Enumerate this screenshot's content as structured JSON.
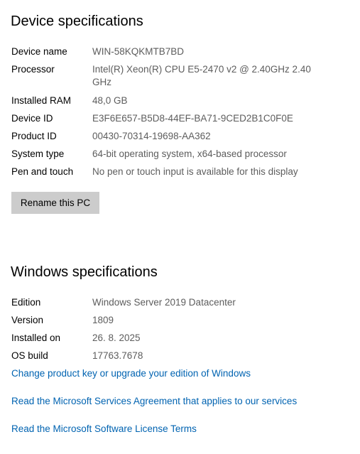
{
  "device": {
    "title": "Device specifications",
    "rows": [
      {
        "label": "Device name",
        "value": "WIN-58KQKMTB7BD"
      },
      {
        "label": "Processor",
        "value": "Intel(R) Xeon(R) CPU E5-2470 v2 @ 2.40GHz   2.40 GHz"
      },
      {
        "label": "Installed RAM",
        "value": "48,0 GB"
      },
      {
        "label": "Device ID",
        "value": "E3F6E657-B5D8-44EF-BA71-9CED2B1C0F0E"
      },
      {
        "label": "Product ID",
        "value": "00430-70314-19698-AA362"
      },
      {
        "label": "System type",
        "value": "64-bit operating system, x64-based processor"
      },
      {
        "label": "Pen and touch",
        "value": "No pen or touch input is available for this display"
      }
    ],
    "rename_label": "Rename this PC"
  },
  "windows": {
    "title": "Windows specifications",
    "rows": [
      {
        "label": "Edition",
        "value": "Windows Server 2019 Datacenter"
      },
      {
        "label": "Version",
        "value": "1809"
      },
      {
        "label": "Installed on",
        "value": "26. 8. 2025"
      },
      {
        "label": "OS build",
        "value": "17763.7678"
      }
    ],
    "links": {
      "change_key": "Change product key or upgrade your edition of Windows",
      "services_agreement": "Read the Microsoft Services Agreement that applies to our services",
      "license_terms": "Read the Microsoft Software License Terms"
    }
  },
  "colors": {
    "link": "#0063b1",
    "value_text": "#5d5d5d",
    "button_bg": "#cccccc"
  }
}
